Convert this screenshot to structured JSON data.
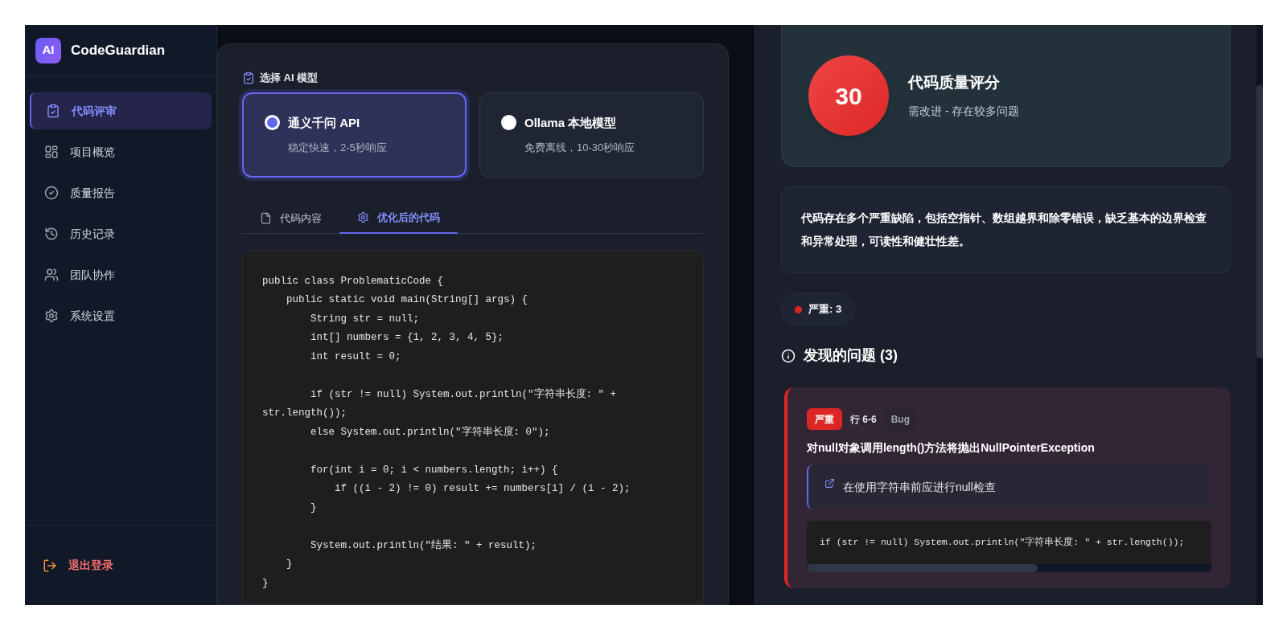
{
  "sidebar": {
    "logo_badge": "AI",
    "app_name": "CodeGuardian",
    "items": [
      {
        "label": "代码评审",
        "selected": true
      },
      {
        "label": "项目概览",
        "selected": false
      },
      {
        "label": "质量报告",
        "selected": false
      },
      {
        "label": "历史记录",
        "selected": false
      },
      {
        "label": "团队协作",
        "selected": false
      },
      {
        "label": "系统设置",
        "selected": false
      }
    ],
    "logout": "退出登录"
  },
  "editor": {
    "section_title": "选择 AI 模型",
    "models": [
      {
        "name": "通义千问 API",
        "description": "稳定快速，2-5秒响应",
        "selected": true
      },
      {
        "name": "Ollama 本地模型",
        "description": "免费离线，10-30秒响应",
        "selected": false
      }
    ],
    "tabs": [
      {
        "label": "代码内容",
        "selected": false
      },
      {
        "label": "优化后的代码",
        "selected": true
      }
    ],
    "code": "public class ProblematicCode {\n    public static void main(String[] args) {\n        String str = null;\n        int[] numbers = {1, 2, 3, 4, 5};\n        int result = 0;\n\n        if (str != null) System.out.println(\"字符串长度: \" + str.length());\n        else System.out.println(\"字符串长度: 0\");\n\n        for(int i = 0; i < numbers.length; i++) {\n            if ((i - 2) != 0) result += numbers[i] / (i - 2);\n        }\n\n        System.out.println(\"结果: \" + result);\n    }\n}"
  },
  "results": {
    "score": "30",
    "score_title": "代码质量评分",
    "score_subtitle": "需改进 - 存在较多问题",
    "summary": "代码存在多个严重缺陷，包括空指针、数组越界和除零错误，缺乏基本的边界检查和异常处理，可读性和健壮性差。",
    "severity_counts": [
      {
        "label": "严重: 3",
        "color": "#dc2626"
      }
    ],
    "issues_heading": "发现的问题 (3)",
    "issues": [
      {
        "severity": "严重",
        "color": "#dc2626",
        "lines": "行 6-6",
        "type": "Bug",
        "title": "对null对象调用length()方法将抛出NullPointerException",
        "suggestion": "在使用字符串前应进行null检查",
        "code": "if (str != null) System.out.println(\"字符串长度: \" + str.length());"
      }
    ]
  }
}
